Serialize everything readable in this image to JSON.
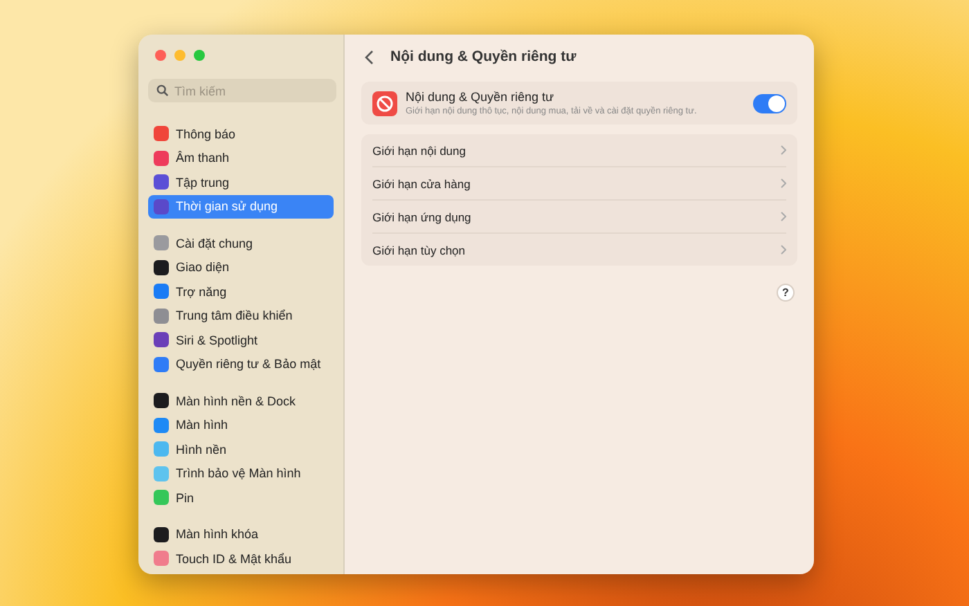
{
  "sidebar": {
    "search": {
      "placeholder": "Tìm kiếm"
    },
    "groups": [
      [
        {
          "label": "Thông báo",
          "color": "#f0453a",
          "selected": false
        },
        {
          "label": "Âm thanh",
          "color": "#ee3b5b",
          "selected": false
        },
        {
          "label": "Tập trung",
          "color": "#5b4fd6",
          "selected": false
        },
        {
          "label": "Thời gian sử dụng",
          "color": "#5a49c9",
          "selected": true
        }
      ],
      [
        {
          "label": "Cài đặt chung",
          "color": "#9a9a9e",
          "selected": false
        },
        {
          "label": "Giao diện",
          "color": "#1c1c1e",
          "selected": false
        },
        {
          "label": "Trợ năng",
          "color": "#1a7cf5",
          "selected": false
        },
        {
          "label": "Trung tâm điều khiển",
          "color": "#8e8e93",
          "selected": false
        },
        {
          "label": "Siri & Spotlight",
          "color": "#6b3fb8",
          "selected": false
        },
        {
          "label": "Quyền riêng tư & Bảo mật",
          "color": "#2f7cf6",
          "selected": false
        }
      ],
      [
        {
          "label": "Màn hình nền & Dock",
          "color": "#1c1c1e",
          "selected": false
        },
        {
          "label": "Màn hình",
          "color": "#1e8af5",
          "selected": false
        },
        {
          "label": "Hình nền",
          "color": "#4cb8ef",
          "selected": false
        },
        {
          "label": "Trình bảo vệ Màn hình",
          "color": "#5ec3ee",
          "selected": false
        },
        {
          "label": "Pin",
          "color": "#35c759",
          "selected": false
        }
      ],
      [
        {
          "label": "Màn hình khóa",
          "color": "#1c1c1e",
          "selected": false
        },
        {
          "label": "Touch ID & Mật khẩu",
          "color": "#f07c8c",
          "selected": false
        }
      ]
    ]
  },
  "main": {
    "title": "Nội dung & Quyền riêng tư",
    "toggle_card": {
      "title": "Nội dung & Quyền riêng tư",
      "description": "Giới hạn nội dung thô tục, nội dung mua, tải về và cài đặt quyền riêng tư.",
      "on": true
    },
    "rows": [
      "Giới hạn nội dung",
      "Giới hạn cửa hàng",
      "Giới hạn ứng dụng",
      "Giới hạn tùy chọn"
    ],
    "help": "?"
  }
}
